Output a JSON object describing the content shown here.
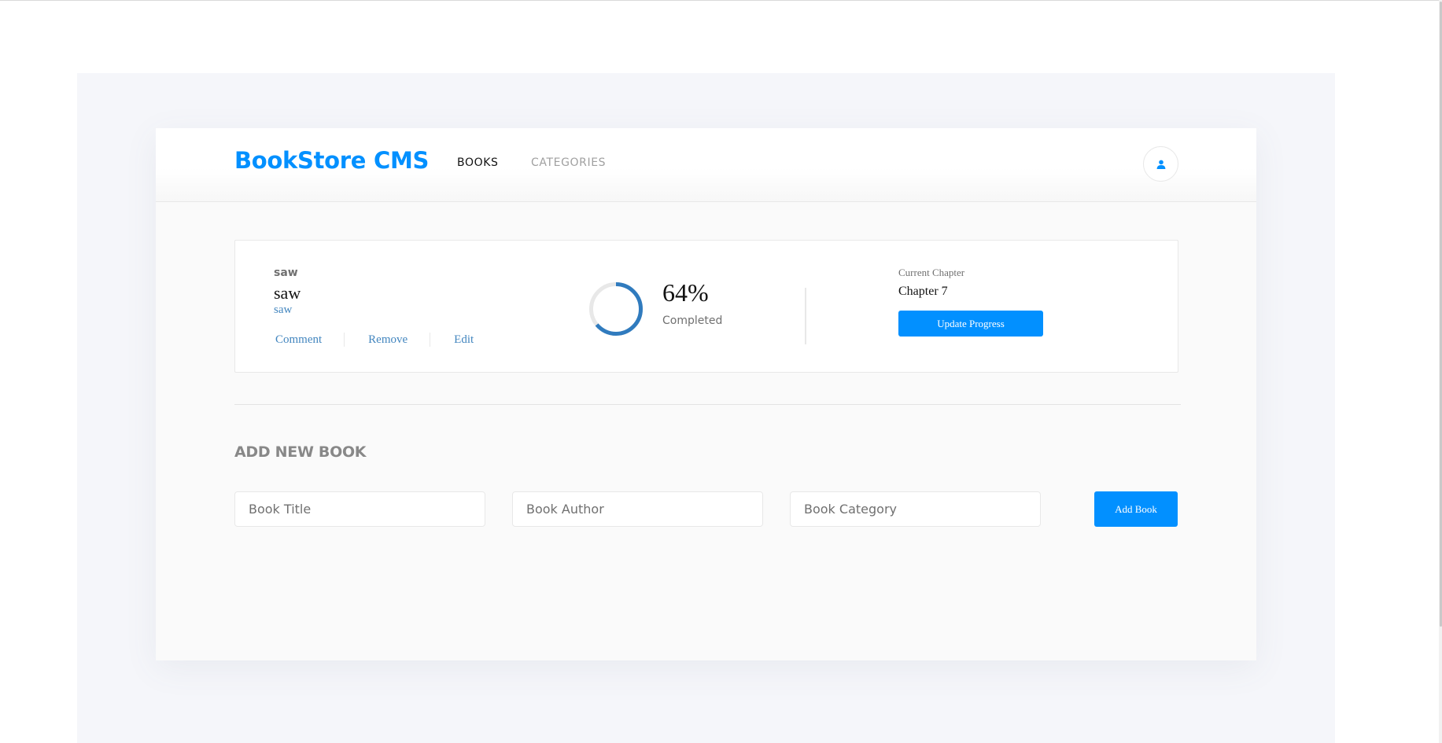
{
  "header": {
    "logo": "BookStore CMS",
    "nav": {
      "books": "BOOKS",
      "categories": "CATEGORIES"
    },
    "avatar_icon": "user-icon"
  },
  "book": {
    "category": "saw",
    "title": "saw",
    "author": "saw",
    "actions": {
      "comment": "Comment",
      "remove": "Remove",
      "edit": "Edit"
    },
    "progress": {
      "percent_text": "64%",
      "percent_value": 0.64,
      "label": "Completed"
    },
    "chapter": {
      "label": "Current Chapter",
      "value": "Chapter 7",
      "button": "Update Progress"
    }
  },
  "form": {
    "title": "ADD NEW BOOK",
    "title_placeholder": "Book Title",
    "author_placeholder": "Book Author",
    "category_placeholder": "Book Category",
    "submit": "Add Book"
  },
  "colors": {
    "accent": "#0290ff",
    "link": "#4386bf",
    "progress_track": "#e8e8e8",
    "progress_fill": "#307bbe"
  }
}
